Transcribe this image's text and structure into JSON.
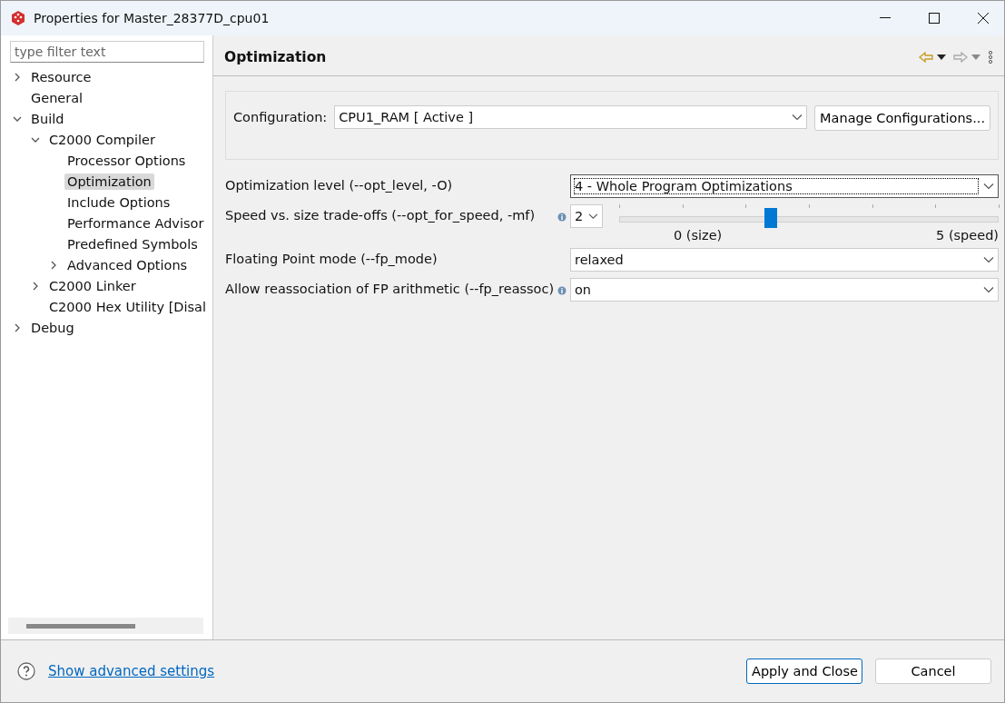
{
  "window": {
    "title": "Properties for Master_28377D_cpu01"
  },
  "filter": {
    "placeholder": "type filter text"
  },
  "tree": [
    {
      "label": "Resource",
      "expanded": false
    },
    {
      "label": "General"
    },
    {
      "label": "Build",
      "expanded": true,
      "children": [
        {
          "label": "C2000 Compiler",
          "expanded": true,
          "children": [
            {
              "label": "Processor Options",
              "selected": false
            },
            {
              "label": "Optimization",
              "selected": true
            },
            {
              "label": "Include Options",
              "selected": false
            },
            {
              "label": "Performance Advisor",
              "selected": false
            },
            {
              "label": "Predefined Symbols",
              "selected": false
            },
            {
              "label": "Advanced Options",
              "expanded": false,
              "selected": false
            }
          ]
        },
        {
          "label": "C2000 Linker",
          "expanded": false
        },
        {
          "label": "C2000 Hex Utility  [Disal"
        }
      ]
    },
    {
      "label": "Debug",
      "expanded": false
    }
  ],
  "page": {
    "title": "Optimization"
  },
  "configuration": {
    "label": "Configuration:",
    "value": "CPU1_RAM  [ Active ]",
    "button": "Manage Configurations..."
  },
  "options": [
    {
      "kind": "select",
      "label": "Optimization level (--opt_level, -O)",
      "value": "4 - Whole Program Optimizations",
      "info": false,
      "focused": true
    },
    {
      "kind": "slider",
      "label": "Speed vs. size trade-offs (--opt_for_speed, -mf)",
      "value": "2",
      "info": true,
      "level": 0.4,
      "min_label": "0 (size)",
      "max_label": "5 (speed)"
    },
    {
      "kind": "select",
      "label": "Floating Point mode (--fp_mode)",
      "value": "relaxed",
      "info": false,
      "focused": false
    },
    {
      "kind": "select",
      "label": "Allow reassociation of FP arithmetic (--fp_reassoc)",
      "value": "on",
      "info": true,
      "focused": false
    }
  ],
  "footer": {
    "link": "Show advanced settings",
    "buttons": [
      {
        "label": "Apply and Close",
        "default": true
      },
      {
        "label": "Cancel",
        "default": false
      }
    ]
  }
}
